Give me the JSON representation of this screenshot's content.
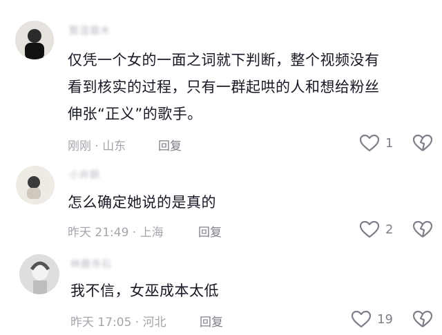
{
  "comments": [
    {
      "username": "暂渲眉木",
      "text_lines": [
        "仅凭一个女的一面之词就下判断，整个视频没有",
        "看到核实的过程，只有一群起哄的人和想给粉丝",
        "伸张“正义”的歌手。"
      ],
      "meta": "刚刚 · 山东",
      "reply_label": "回复",
      "like_count": "1"
    },
    {
      "username": "小井鹊",
      "text_lines": [
        "怎么确定她说的是真的"
      ],
      "meta": "昨天 21:49 · 上海",
      "reply_label": "回复",
      "like_count": "2"
    },
    {
      "username": "林鹿寺石",
      "text_lines": [
        "我不信，女巫成本太低"
      ],
      "meta": "昨天 17:05 · 河北",
      "reply_label": "回复",
      "like_count": "19"
    }
  ],
  "colors": {
    "text": "#161823",
    "meta": "#a2a5ab",
    "icon": "#7d8089"
  },
  "icons": {
    "like": "heart-outline-icon",
    "dislike": "broken-heart-icon"
  }
}
